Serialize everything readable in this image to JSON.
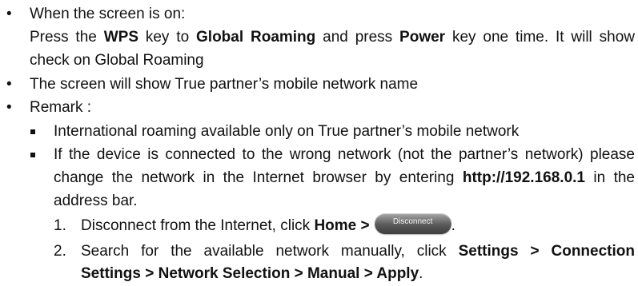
{
  "bullets": {
    "dot": "•",
    "square": "■"
  },
  "item1": {
    "heading": "When the screen is on:",
    "line1_a": "Press the ",
    "line1_b": "WPS",
    "line1_c": " key to ",
    "line1_d": "Global Roaming",
    "line1_e": " and press ",
    "line1_f": "Power",
    "line1_g": " key one time. It will show",
    "line2": "check on Global Roaming"
  },
  "item2": {
    "text": "The screen will show True partner’s mobile network name"
  },
  "item3": {
    "heading": "Remark :",
    "sub1": "International roaming available only on True partner’s mobile network",
    "sub2_line1": "If the device is connected to the wrong network (not the partner’s network) please",
    "sub2_line2_a": "change the network in the Internet browser by entering ",
    "sub2_line2_b": "http://192.168.0.1",
    "sub2_line2_c": " in the",
    "sub2_line3": "address bar.",
    "step1_num": "1.",
    "step1_a": "Disconnect from the Internet, click ",
    "step1_b": "Home >",
    "step1_button": "Disconnect",
    "step1_end": ".",
    "step2_num": "2.",
    "step2_a": "Search for the available network manually, click ",
    "step2_b": "Settings > Connection",
    "step2_line2": "Settings > Network Selection > Manual > Apply",
    "step2_end": "."
  }
}
